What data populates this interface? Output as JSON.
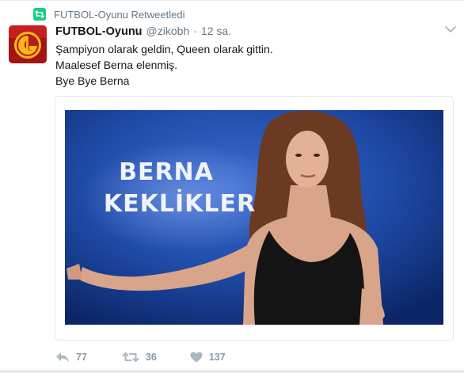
{
  "retweet_context": {
    "icon": "retweet-icon",
    "text": "FUTBOL-Oyunu Retweetledi"
  },
  "tweet": {
    "avatar_icon": "galatasaray-logo-icon",
    "display_name": "FUTBOL-Oyunu",
    "handle": "@zikobh",
    "separator": "·",
    "time": "12 sa.",
    "lines": [
      "Şampiyon olarak geldin, Queen olarak gittin.",
      "Maalesef Berna elenmiş.",
      "Bye Bye Berna"
    ],
    "media": {
      "overlay_line1": "BERNA",
      "overlay_line2": "KEKLİKLER"
    },
    "actions": {
      "reply": {
        "icon": "reply-icon",
        "count": "77"
      },
      "retweet": {
        "icon": "retweet-icon",
        "count": "36"
      },
      "like": {
        "icon": "heart-icon",
        "count": "137"
      }
    },
    "colors": {
      "retweet_green": "#19cf86",
      "secondary_text": "#657786",
      "action_grey": "#8899a6"
    }
  }
}
